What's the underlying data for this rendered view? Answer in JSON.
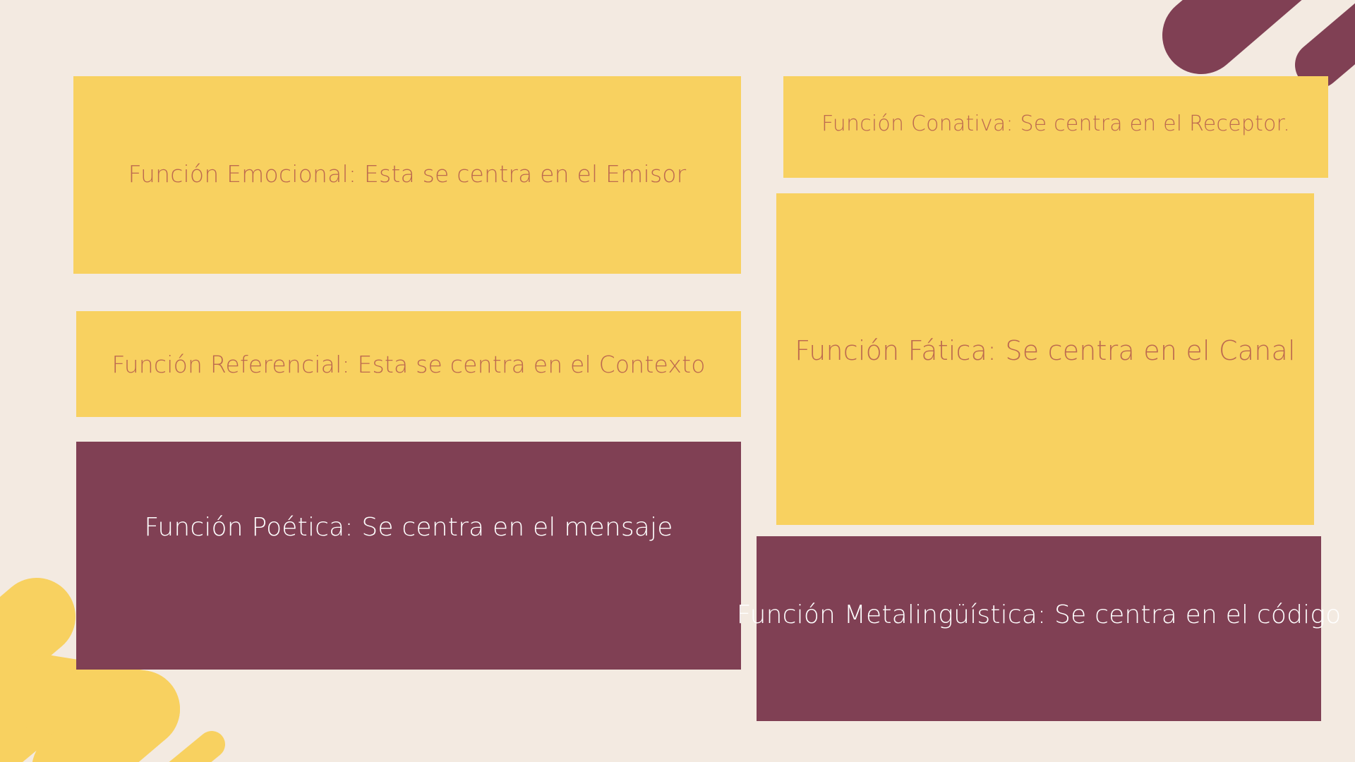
{
  "colors": {
    "background": "#F3EAE1",
    "yellow": "#F8D160",
    "plum": "#804054",
    "yellow_text": "#BD6A4F",
    "plum_text": "#FFFFFF"
  },
  "cards": {
    "emocional": "Función Emocional: Esta se centra en el Emisor",
    "referencial": "Función Referencial: Esta se centra en el Contexto",
    "poetica": "Función Poética: Se centra en el mensaje",
    "conativa": "Función Conativa: Se centra en el Receptor.",
    "fatica": "Función Fática: Se centra en el Canal",
    "metalinguistica": "Función Metalingüística: Se centra en el código"
  }
}
